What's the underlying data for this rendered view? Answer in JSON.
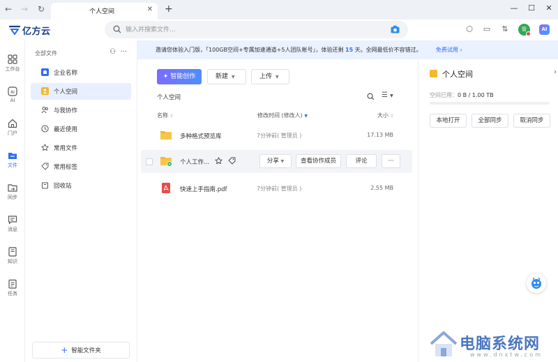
{
  "browser": {
    "tab_title": "个人空间",
    "back": "←",
    "forward": "→",
    "reload": "↻",
    "close_tab": "✕",
    "new_tab": "+",
    "minimize": "—",
    "maximize": "☐",
    "close_window": "✕"
  },
  "app": {
    "brand": "亿方云",
    "search_placeholder": "输入并搜索文件...",
    "avatar_text": "管",
    "ai_label": "AI"
  },
  "rail": [
    {
      "label": "工作台",
      "icon": "grid-icon"
    },
    {
      "label": "AI",
      "icon": "ai-icon"
    },
    {
      "label": "门户",
      "icon": "home-icon"
    },
    {
      "label": "文件",
      "icon": "folder-icon"
    },
    {
      "label": "同步",
      "icon": "sync-folder-icon"
    },
    {
      "label": "消息",
      "icon": "message-icon"
    },
    {
      "label": "知识",
      "icon": "book-icon"
    },
    {
      "label": "任务",
      "icon": "task-icon"
    }
  ],
  "tree": {
    "header": "全部文件",
    "items": [
      {
        "label": "企业名称",
        "icon": "enterprise-icon"
      },
      {
        "label": "个人空间",
        "icon": "personal-space-icon"
      },
      {
        "label": "与我协作",
        "icon": "collaboration-icon"
      },
      {
        "label": "最近使用",
        "icon": "clock-icon"
      },
      {
        "label": "常用文件",
        "icon": "star-icon"
      },
      {
        "label": "常用标签",
        "icon": "tag-icon"
      },
      {
        "label": "回收站",
        "icon": "trash-icon"
      }
    ],
    "smart_folder": "智能文件夹"
  },
  "banner": {
    "text_before": "邀请您体验入门版，「100GB空间+专属加速通道+5人团队帐号」，体验还剩 ",
    "days": "15",
    "text_after": " 天。全网最低价不容错过。",
    "link": "免费试用"
  },
  "toolbar": {
    "smart_create": "智能创作",
    "new": "新建",
    "upload": "上传"
  },
  "breadcrumb": "个人空间",
  "columns": {
    "name": "名称",
    "modified": "修改时间 (修改人)",
    "size": "大小"
  },
  "files": [
    {
      "name": "多种格式预览库",
      "time": "7分钟前( 管理员 )",
      "size": "17.13 MB",
      "icon": "folder-icon"
    },
    {
      "name": "个人工作...",
      "icon": "shared-folder-icon"
    },
    {
      "name": "快速上手指南.pdf",
      "time": "7分钟前( 管理员 )",
      "size": "2.55 MB",
      "icon": "pdf-icon"
    }
  ],
  "row_actions": {
    "share": "分享",
    "view_members": "查看协作成员",
    "comment": "评论",
    "more": "···"
  },
  "side": {
    "title": "个人空间",
    "usage_label": "空间已用：",
    "usage_value": "0 B / 1.00 TB",
    "usage_fraction": 0,
    "open_local": "本地打开",
    "sync_all": "全部同步",
    "cancel_sync": "取消同步"
  },
  "watermark": {
    "title": "电脑系统网",
    "url": "www.dnxtw.com"
  }
}
